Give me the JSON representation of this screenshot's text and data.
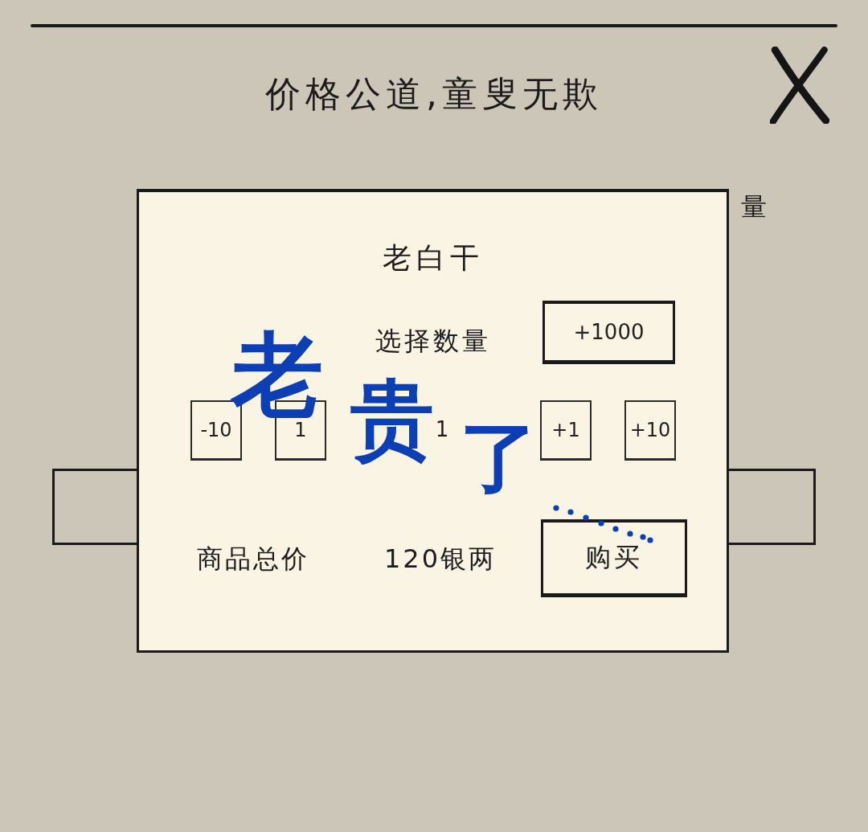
{
  "header": {
    "title": "价格公道,童叟无欺"
  },
  "background": {
    "column_header": "量"
  },
  "dialog": {
    "item_name": "老白干",
    "quantity_label": "选择数量",
    "quick_add_button": "+1000",
    "quantity": {
      "decrease_buttons": [
        "-10",
        "1"
      ],
      "value": "1",
      "increase_buttons": [
        "+1",
        "+10"
      ]
    },
    "total": {
      "label": "商品总价",
      "price": "120银两"
    },
    "buy_button": "购买"
  },
  "annotation": {
    "characters": [
      "老",
      "贵",
      "了"
    ]
  }
}
